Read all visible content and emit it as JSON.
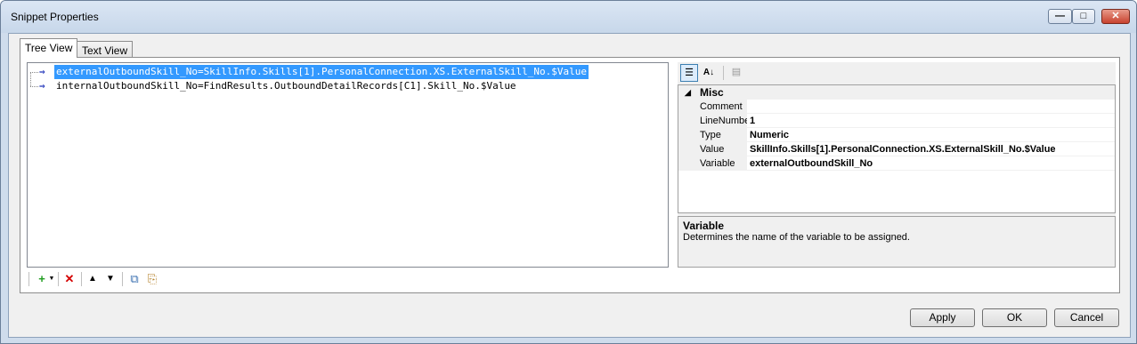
{
  "window": {
    "title": "Snippet Properties"
  },
  "tabs": [
    {
      "label": "Tree View",
      "active": true
    },
    {
      "label": "Text View",
      "active": false
    }
  ],
  "tree": {
    "items": [
      {
        "text": "externalOutboundSkill_No=SkillInfo.Skills[1].PersonalConnection.XS.ExternalSkill_No.$Value",
        "selected": true
      },
      {
        "text": "internalOutboundSkill_No=FindResults.OutboundDetailRecords[C1].Skill_No.$Value",
        "selected": false
      }
    ]
  },
  "property_grid": {
    "category": "Misc",
    "rows": [
      {
        "name": "Comment",
        "value": ""
      },
      {
        "name": "LineNumbe",
        "value": "1"
      },
      {
        "name": "Type",
        "value": "Numeric"
      },
      {
        "name": "Value",
        "value": "SkillInfo.Skills[1].PersonalConnection.XS.ExternalSkill_No.$Value"
      },
      {
        "name": "Variable",
        "value": "externalOutboundSkill_No"
      }
    ],
    "description": {
      "title": "Variable",
      "text": "Determines the name of the variable to be assigned."
    }
  },
  "buttons": {
    "apply": "Apply",
    "ok": "OK",
    "cancel": "Cancel"
  },
  "colors": {
    "selection": "#3399ff",
    "arrow": "#1c2fb8",
    "delete": "#d40000",
    "add": "#1f9c1f"
  }
}
